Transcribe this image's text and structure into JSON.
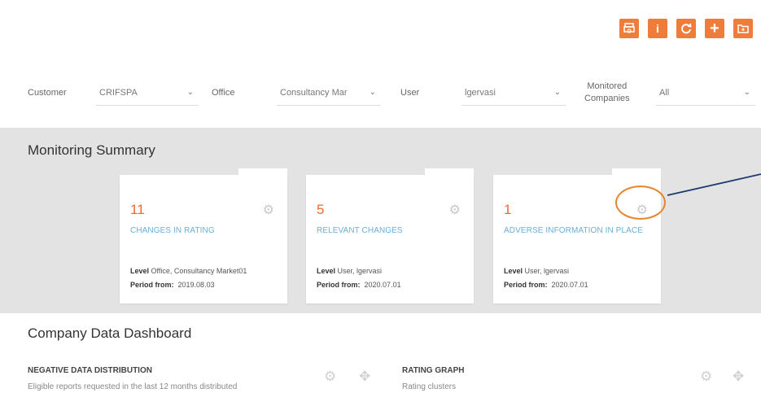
{
  "toolbar": {
    "buttons": [
      {
        "name": "print-icon",
        "label": ""
      },
      {
        "name": "info-icon",
        "label": "i"
      },
      {
        "name": "refresh-icon",
        "label": ""
      },
      {
        "name": "add-icon",
        "label": "+"
      },
      {
        "name": "new-folder-icon",
        "label": ""
      }
    ]
  },
  "filters": {
    "customer_label": "Customer",
    "customer_value": "CRIFSPA",
    "office_label": "Office",
    "office_value": "Consultancy Mar",
    "user_label": "User",
    "user_value": "lgervasi",
    "monitored_label_1": "Monitored",
    "monitored_label_2": "Companies",
    "monitored_value": "All"
  },
  "summary": {
    "title": "Monitoring Summary",
    "cards": [
      {
        "count": "11",
        "title": "CHANGES IN RATING",
        "level_label": "Level",
        "level_value": "Office, Consultancy Market01",
        "period_label": "Period from:",
        "period_value": "2019.08.03"
      },
      {
        "count": "5",
        "title": "RELEVANT CHANGES",
        "level_label": "Level",
        "level_value": "User, lgervasi",
        "period_label": "Period from:",
        "period_value": "2020.07.01"
      },
      {
        "count": "1",
        "title": "ADVERSE INFORMATION IN PLACE",
        "level_label": "Level",
        "level_value": "User, lgervasi",
        "period_label": "Period from:",
        "period_value": "2020.07.01"
      }
    ]
  },
  "dashboard": {
    "title": "Company Data Dashboard",
    "panel1_title": "NEGATIVE DATA DISTRIBUTION",
    "panel1_subtitle": "Eligible reports requested in the last 12 months distributed",
    "panel2_title": "RATING GRAPH",
    "panel2_subtitle": "Rating clusters"
  },
  "colors": {
    "accent": "#f07c3a",
    "count": "#ee6a2f",
    "link": "#6aaed6",
    "annotation_circle": "#e8832e",
    "annotation_line": "#1f3a6e"
  }
}
